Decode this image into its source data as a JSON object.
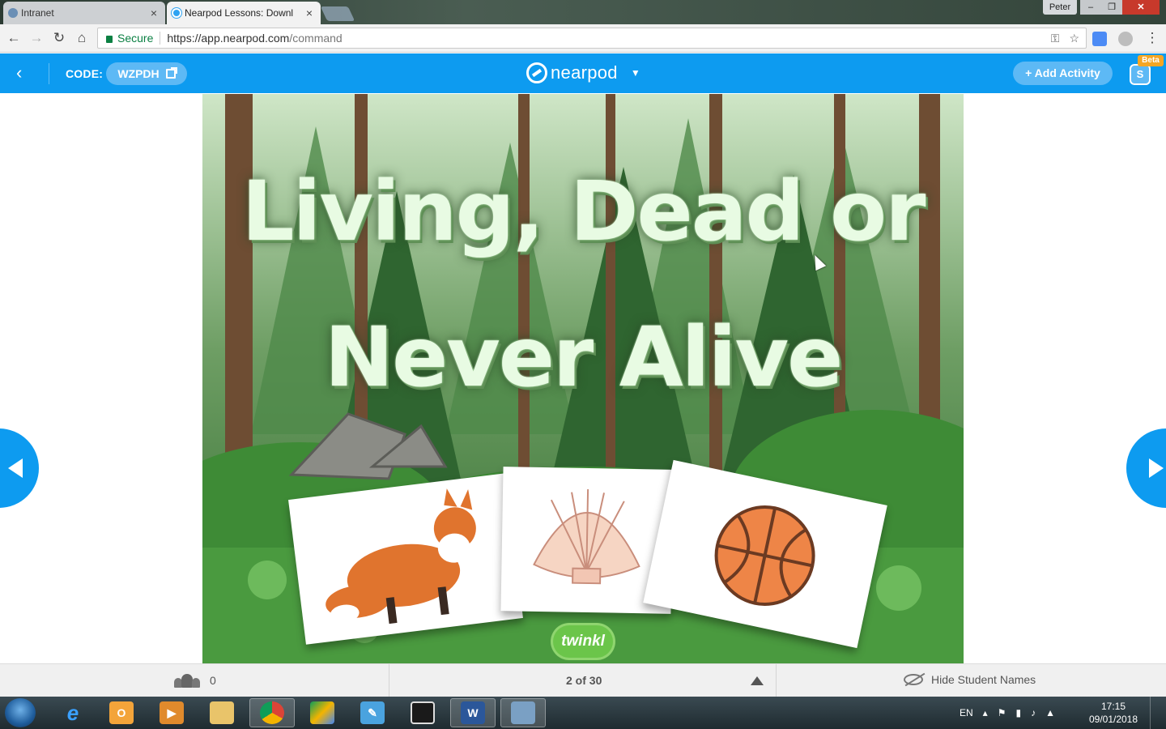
{
  "browser": {
    "tabs": [
      {
        "title": "Intranet",
        "close": "×"
      },
      {
        "title": "Nearpod Lessons: Downl",
        "close": "×"
      }
    ],
    "user": "Peter",
    "window_buttons": {
      "minimize": "–",
      "maximize": "❐",
      "close": "✕"
    },
    "nav": {
      "back": "←",
      "forward": "→",
      "reload": "↻",
      "home": "⌂"
    },
    "omnibox": {
      "secure_label": "Secure",
      "url_base": "https://app.nearpod.com",
      "url_path": "/command",
      "key_icon": "⚿",
      "star_icon": "☆"
    },
    "menu_icon": "⋮"
  },
  "nearpod": {
    "back_glyph": "‹",
    "code_label": "CODE:",
    "code_value": "WZPDH",
    "brand": "nearpod",
    "brand_caret": "▼",
    "add_activity": "+ Add Activity",
    "share_glyph": "S",
    "beta_badge": "Beta",
    "accent": "#0d9bf0"
  },
  "slide": {
    "title_line1": "Living, Dead or",
    "title_line2": "Never Alive",
    "cards": [
      "fox",
      "shell",
      "basketball"
    ],
    "watermark": "twinkl"
  },
  "bottom_bar": {
    "student_count": "0",
    "page_indicator": "2 of 30",
    "hide_names_label": "Hide Student Names"
  },
  "taskbar": {
    "apps": [
      "internet-explorer",
      "outlook",
      "media-player",
      "file-explorer",
      "chrome",
      "google-drive",
      "notepad",
      "screen-capture",
      "word",
      "utility"
    ],
    "language": "EN",
    "time": "17:15",
    "date": "09/01/2018"
  }
}
